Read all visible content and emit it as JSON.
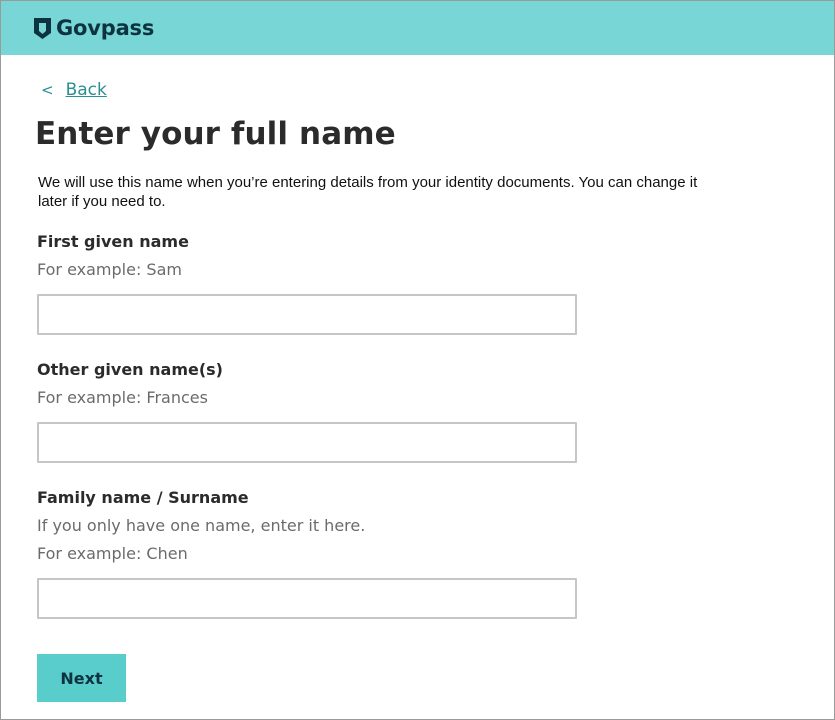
{
  "header": {
    "brand": "Govpass",
    "logo_icon": "shield-icon",
    "bg_color": "#78d7d6"
  },
  "nav": {
    "back_chevron": "<",
    "back_label": "Back"
  },
  "page": {
    "title": "Enter your full name",
    "intro": "We will use this name when you’re entering details from your identity documents. You can change it later if you need to."
  },
  "fields": {
    "first_given_name": {
      "label": "First given name",
      "hint": "For example: Sam",
      "value": ""
    },
    "other_given_names": {
      "label": "Other given name(s)",
      "hint": "For example: Frances",
      "value": ""
    },
    "family_name": {
      "label": "Family name / Surname",
      "note": "If you only have one name, enter it here.",
      "hint": "For example: Chen",
      "value": ""
    }
  },
  "actions": {
    "next_label": "Next",
    "next_color": "#58cdcc"
  }
}
